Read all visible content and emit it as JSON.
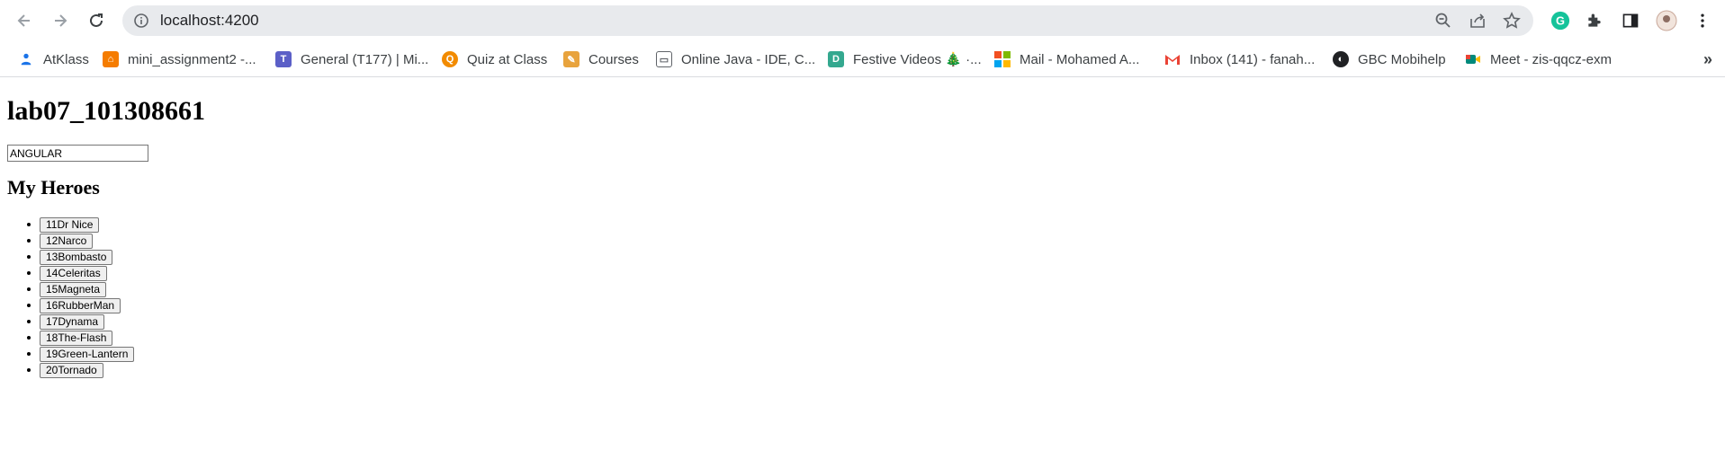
{
  "browser": {
    "url": "localhost:4200"
  },
  "bookmarks": [
    {
      "label": "AtKlass",
      "icon": "atklass-icon",
      "color": "#1a73e8"
    },
    {
      "label": "mini_assignment2 -...",
      "icon": "orgchart-icon",
      "color": "#f57c00"
    },
    {
      "label": "General (T177) | Mi...",
      "icon": "teams-icon",
      "color": "#5b5fc7"
    },
    {
      "label": "Quiz at Class",
      "icon": "quiz-icon",
      "color": "#f28b00"
    },
    {
      "label": "Courses",
      "icon": "courses-icon",
      "color": "#e8a33d"
    },
    {
      "label": "Online Java - IDE, C...",
      "icon": "ide-icon",
      "color": "#5f6368"
    },
    {
      "label": "Festive Videos 🎄 ·...",
      "icon": "festive-icon",
      "color": "#34a88f"
    },
    {
      "label": "Mail - Mohamed A...",
      "icon": "microsoft-icon",
      "color": "#f25022"
    },
    {
      "label": "Inbox (141) - fanah...",
      "icon": "gmail-icon",
      "color": "#ea4335"
    },
    {
      "label": "GBC Mobihelp",
      "icon": "gbc-icon",
      "color": "#202124"
    },
    {
      "label": "Meet - zis-qqcz-exm",
      "icon": "meet-icon",
      "color": "#00897b"
    }
  ],
  "bookmarks_more": "»",
  "page": {
    "title": "lab07_101308661",
    "input_value": "ANGULAR",
    "heroes_heading": "My Heroes",
    "heroes": [
      "11Dr Nice",
      "12Narco",
      "13Bombasto",
      "14Celeritas",
      "15Magneta",
      "16RubberMan",
      "17Dynama",
      "18The-Flash",
      "19Green-Lantern",
      "20Tornado"
    ]
  }
}
